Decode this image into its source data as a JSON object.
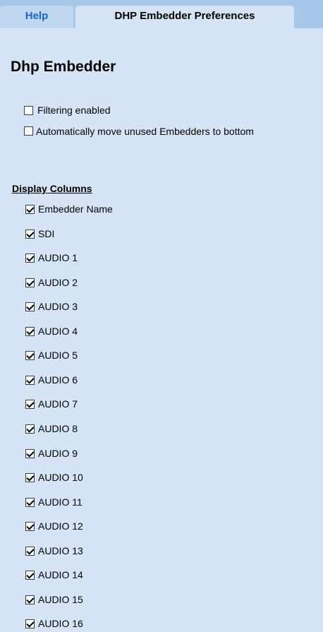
{
  "tabs": [
    {
      "label": "Help",
      "active": false
    },
    {
      "label": "DHP Embedder Preferences",
      "active": true
    }
  ],
  "title": "Dhp Embedder",
  "options": [
    {
      "label": "Filtering enabled",
      "checked": false
    },
    {
      "label": "Automatically move unused Embedders to bottom",
      "checked": false
    }
  ],
  "display_columns": {
    "heading": "Display Columns",
    "items": [
      {
        "label": "Embedder Name",
        "checked": true
      },
      {
        "label": "SDI",
        "checked": true
      },
      {
        "label": "AUDIO 1",
        "checked": true
      },
      {
        "label": "AUDIO 2",
        "checked": true
      },
      {
        "label": "AUDIO 3",
        "checked": true
      },
      {
        "label": "AUDIO 4",
        "checked": true
      },
      {
        "label": "AUDIO 5",
        "checked": true
      },
      {
        "label": "AUDIO 6",
        "checked": true
      },
      {
        "label": "AUDIO 7",
        "checked": true
      },
      {
        "label": "AUDIO 8",
        "checked": true
      },
      {
        "label": "AUDIO 9",
        "checked": true
      },
      {
        "label": "AUDIO 10",
        "checked": true
      },
      {
        "label": "AUDIO 11",
        "checked": true
      },
      {
        "label": "AUDIO 12",
        "checked": true
      },
      {
        "label": "AUDIO 13",
        "checked": true
      },
      {
        "label": "AUDIO 14",
        "checked": true
      },
      {
        "label": "AUDIO 15",
        "checked": true
      },
      {
        "label": "AUDIO 16",
        "checked": true
      }
    ]
  },
  "colors": {
    "background": "#d4e4f4",
    "tabbar": "#a9c7ea",
    "help_tab_text": "#1f63c6"
  }
}
